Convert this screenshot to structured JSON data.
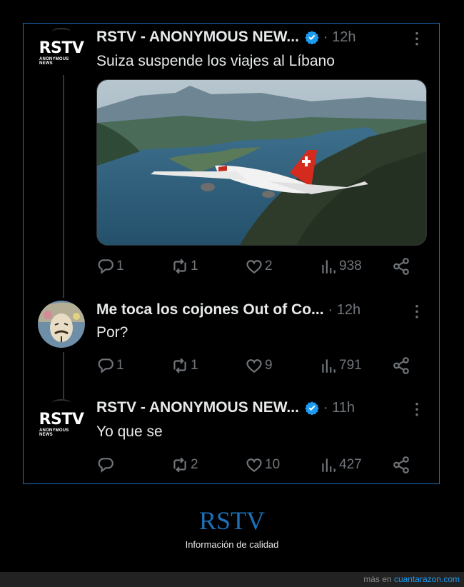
{
  "tweets": [
    {
      "avatar": {
        "logo_text": "RSTV",
        "logo_sub": "ANONYMOUS NEWS"
      },
      "name": "RSTV - ANONYMOUS NEW...",
      "time": "· 12h",
      "text": "Suiza suspende los viajes al Líbano",
      "actions": {
        "replies": "1",
        "retweets": "1",
        "likes": "2",
        "views": "938"
      }
    },
    {
      "name": "Me toca los cojones Out of Co...",
      "time": "· 12h",
      "text": "Por?",
      "actions": {
        "replies": "1",
        "retweets": "1",
        "likes": "9",
        "views": "791"
      }
    },
    {
      "avatar": {
        "logo_text": "RSTV",
        "logo_sub": "ANONYMOUS NEWS"
      },
      "name": "RSTV - ANONYMOUS NEW...",
      "time": "· 11h",
      "text": "Yo que se",
      "actions": {
        "replies": "",
        "retweets": "2",
        "likes": "10",
        "views": "427"
      }
    }
  ],
  "colors": {
    "accent": "#1d6fb8",
    "verified": "#1d9bf0",
    "muted": "#71767b",
    "text": "#e7e9ea"
  },
  "footer": {
    "title": "RSTV",
    "subtitle": "Información de calidad",
    "credit_prefix": "más en",
    "credit_link": "cuantarazon.com"
  }
}
